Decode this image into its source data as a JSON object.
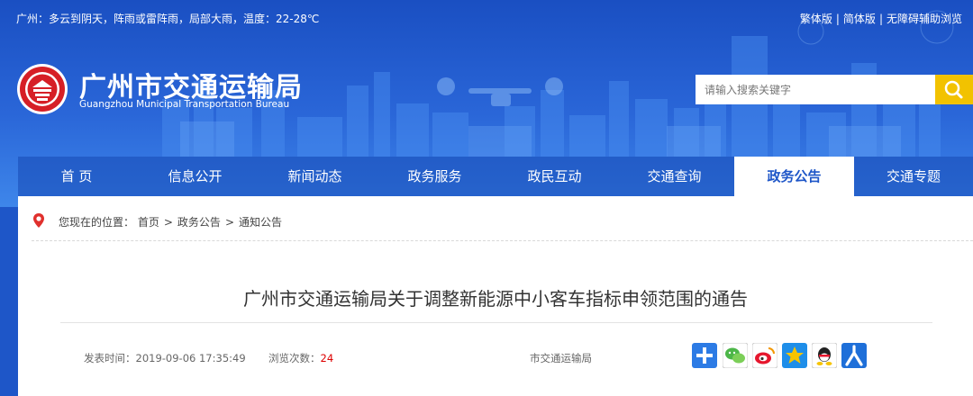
{
  "topbar": {
    "weather": "广州：多云到阴天，阵雨或雷阵雨，局部大雨，温度：22-28℃",
    "links": [
      "繁体版",
      "简体版",
      "无障碍辅助浏览"
    ],
    "separator": "|"
  },
  "site": {
    "title_cn": "广州市交通运输局",
    "title_en": "Guangzhou Municipal Transportation Bureau"
  },
  "search": {
    "placeholder": "请输入搜索关键字"
  },
  "nav": {
    "items": [
      "首 页",
      "信息公开",
      "新闻动态",
      "政务服务",
      "政民互动",
      "交通查询",
      "政务公告",
      "交通专题"
    ],
    "active": "政务公告"
  },
  "breadcrumb": {
    "prefix": "您现在的位置：",
    "items": [
      "首页",
      "政务公告",
      "通知公告"
    ],
    "separator": ">"
  },
  "article": {
    "title": "广州市交通运输局关于调整新能源中小客车指标申领范围的通告",
    "publish_label": "发表时间：",
    "publish_time": "2019-09-06 17:35:49",
    "views_label": "浏览次数：",
    "views": "24",
    "source": "市交通运输局"
  },
  "share": [
    "plus-icon",
    "wechat-icon",
    "weibo-icon",
    "qzone-icon",
    "qq-icon",
    "renren-icon"
  ],
  "colors": {
    "header_blue": "#1e56c8",
    "accent_yellow": "#f2c200",
    "logo_red": "#d61f26",
    "count_red": "#dd0000"
  }
}
